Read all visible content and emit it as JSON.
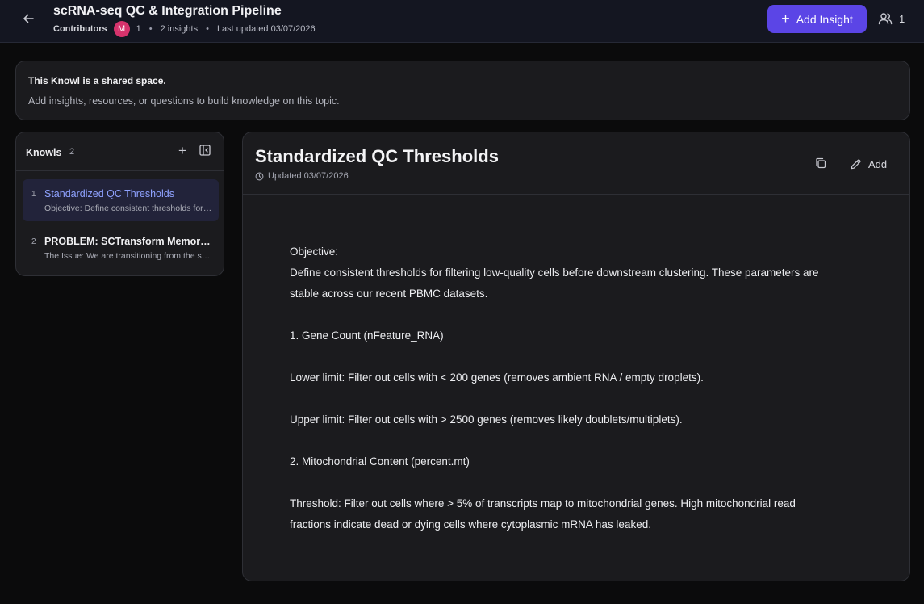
{
  "header": {
    "title": "scRNA-seq QC & Integration Pipeline",
    "contributors_label": "Contributors",
    "avatar_initial": "M",
    "contributors_count": "1",
    "insights": "2 insights",
    "last_updated": "Last updated 03/07/2026",
    "add_insight_label": "Add Insight",
    "members_count": "1"
  },
  "banner": {
    "heading": "This Knowl is a shared space.",
    "text": "Add insights, resources, or questions to build knowledge on this topic."
  },
  "sidebar": {
    "title": "Knowls",
    "count": "2",
    "items": [
      {
        "number": "1",
        "name": "Standardized QC Thresholds",
        "snippet": "Objective: Define consistent thresholds for filtering low-quality cells before downstream clustering."
      },
      {
        "number": "2",
        "name": "PROBLEM: SCTransform Memory Overflow",
        "snippet": "The Issue: We are transitioning from the standard normalization workflow."
      }
    ]
  },
  "document": {
    "title": "Standardized QC Thresholds",
    "updated": "Updated 03/07/2026",
    "add_label": "Add",
    "lines": [
      "Objective:",
      "Define consistent thresholds for filtering low-quality cells before downstream clustering. These parameters are",
      "stable across our recent PBMC datasets.",
      "",
      "1. Gene Count (nFeature_RNA)",
      "",
      "Lower limit: Filter out cells with < 200 genes (removes ambient RNA / empty droplets).",
      "",
      "Upper limit: Filter out cells with > 2500 genes (removes likely doublets/multiplets).",
      "",
      "2. Mitochondrial Content (percent.mt)",
      "",
      "Threshold: Filter out cells where > 5% of transcripts map to mitochondrial genes. High mitochondrial read",
      "fractions indicate dead or dying cells where cytoplasmic mRNA has leaked."
    ]
  },
  "colors": {
    "accent": "#5b45e6",
    "active_link": "#8fa2ff",
    "avatar": "#d6336c"
  },
  "icons": [
    "back-arrow-icon",
    "plus-icon",
    "users-icon",
    "collapse-sidebar-icon",
    "clock-icon",
    "copy-icon",
    "pencil-icon"
  ]
}
